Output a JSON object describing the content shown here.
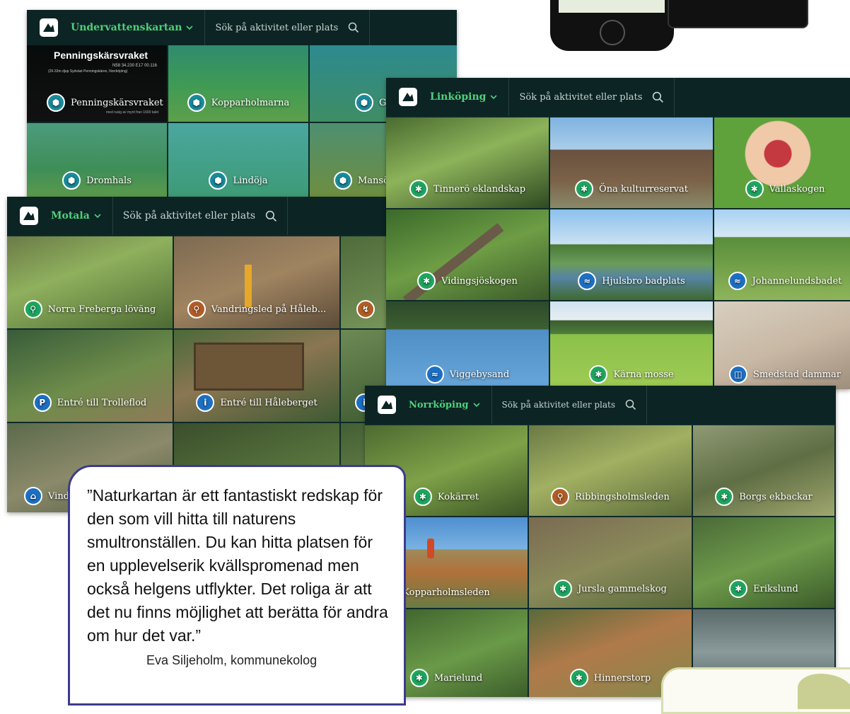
{
  "search_placeholder": "Sök på aktivitet eller plats",
  "panels": {
    "undervatten": {
      "location": "Undervattenskartan",
      "featured": {
        "title": "Penningskärsvraket",
        "coords": "N58 34.230 E17 00.116",
        "depth_note": "(26-33m djup Sydväst Penningskären, Norrköping)",
        "caption": "med rusig av mynt fran 1600 talet"
      },
      "tiles": [
        {
          "label": "Penningskärsvraket",
          "icon": "shield-icon"
        },
        {
          "label": "Kopparholmarna",
          "icon": "shield-icon"
        },
        {
          "label": "Ge",
          "icon": "shield-icon"
        },
        {
          "label": "Dromhals",
          "icon": "shield-icon"
        },
        {
          "label": "Lindöja",
          "icon": "shield-icon"
        },
        {
          "label": "Mansö",
          "icon": "shield-icon"
        }
      ]
    },
    "motala": {
      "location": "Motala",
      "tiles": [
        {
          "label": "Norra Freberga löväng",
          "icon": "hiking-icon"
        },
        {
          "label": "Vandringsled på Håleb...",
          "icon": "hiking-icon"
        },
        {
          "label": "",
          "icon": "running-icon"
        },
        {
          "label": "Entré till Trolleflod",
          "icon": "parking-icon"
        },
        {
          "label": "Entré till Håleberget",
          "icon": "info-icon"
        },
        {
          "label": "",
          "icon": "info-icon"
        },
        {
          "label": "Vind",
          "icon": "shelter-icon"
        },
        {
          "label": "",
          "icon": ""
        },
        {
          "label": "",
          "icon": ""
        }
      ]
    },
    "linkoping": {
      "location": "Linköping",
      "tiles": [
        {
          "label": "Tinnerö eklandskap",
          "icon": "nature-reserve-icon"
        },
        {
          "label": "Öna kulturreservat",
          "icon": "nature-reserve-icon"
        },
        {
          "label": "Vallaskogen",
          "icon": "nature-reserve-icon"
        },
        {
          "label": "Vidingsjöskogen",
          "icon": "nature-reserve-icon"
        },
        {
          "label": "Hjulsbro badplats",
          "icon": "swimming-icon"
        },
        {
          "label": "Johannelundsbadet",
          "icon": "swimming-icon"
        },
        {
          "label": "Viggebysand",
          "icon": "swimming-icon"
        },
        {
          "label": "Kärna mosse",
          "icon": "nature-reserve-icon"
        },
        {
          "label": "Smedstad dammar",
          "icon": "bird-hide-icon"
        }
      ]
    },
    "norrkoping": {
      "location": "Norrköping",
      "tiles": [
        {
          "label": "Kokärret",
          "icon": "nature-reserve-icon"
        },
        {
          "label": "Ribbingsholmsleden",
          "icon": "hiking-icon"
        },
        {
          "label": "Borgs ekbackar",
          "icon": "nature-reserve-icon"
        },
        {
          "label": "Kopparholmsleden",
          "icon": ""
        },
        {
          "label": "Jursla gammelskog",
          "icon": "nature-reserve-icon"
        },
        {
          "label": "Erikslund",
          "icon": "nature-reserve-icon"
        },
        {
          "label": "Marielund",
          "icon": "nature-reserve-icon"
        },
        {
          "label": "Hinnerstorp",
          "icon": "nature-reserve-icon"
        },
        {
          "label": "",
          "icon": ""
        }
      ]
    }
  },
  "quote": {
    "text": "”Naturkartan är ett fantastiskt redskap för den som vill hitta till naturens smultronställen. Du kan hitta platsen för en upplevelserik kvällspromenad men också helgens utflykter. Det roliga är att det nu finns möjlighet att berätta för andra om hur det var.”",
    "author": "Eva Siljeholm, kommunekolog"
  },
  "colors": {
    "topbar": "#0c2424",
    "accent": "#4fd07b",
    "quote_border": "#3d3b8c"
  }
}
